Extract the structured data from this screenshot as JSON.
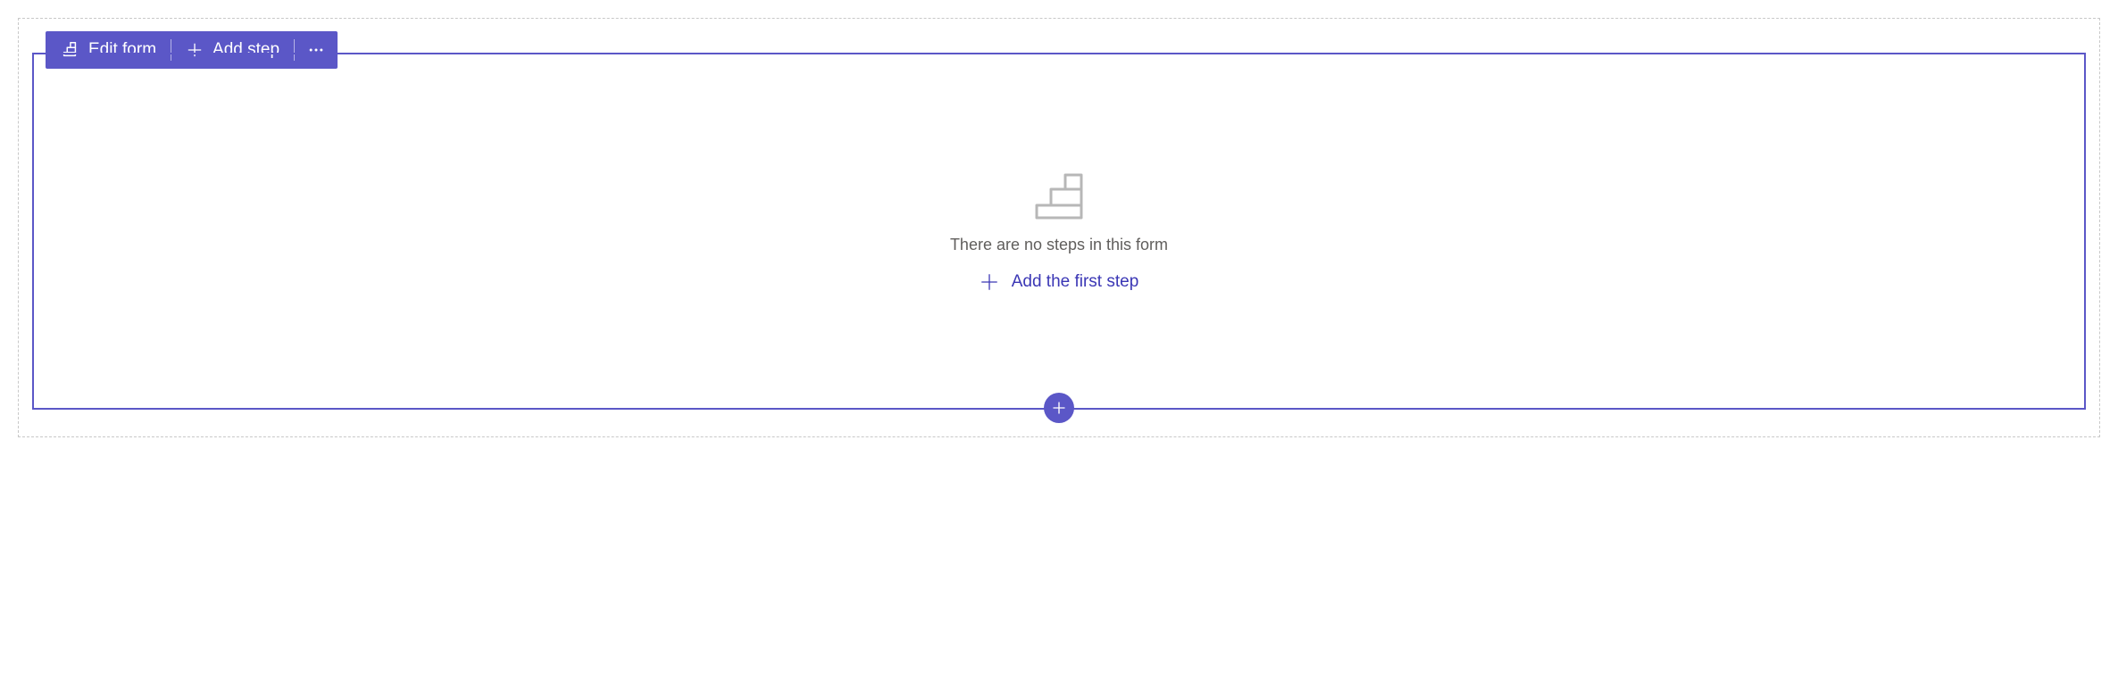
{
  "toolbar": {
    "edit_form_label": "Edit form",
    "add_step_label": "Add step"
  },
  "empty_state": {
    "message": "There are no steps in this form",
    "add_first_label": "Add the first step"
  },
  "colors": {
    "accent": "#5b57c7",
    "link": "#3b37b5",
    "muted": "#605e5c",
    "icon_gray": "#b7b7b7"
  }
}
